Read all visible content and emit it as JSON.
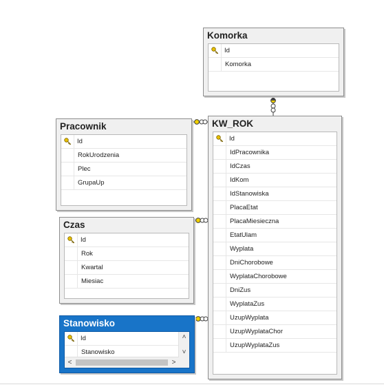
{
  "tables": {
    "komorka": {
      "title": "Komorka",
      "columns": [
        "Id",
        "Komorka"
      ]
    },
    "pracownik": {
      "title": "Pracownik",
      "columns": [
        "Id",
        "RokUrodzenia",
        "Plec",
        "GrupaUp"
      ]
    },
    "czas": {
      "title": "Czas",
      "columns": [
        "Id",
        "Rok",
        "Kwartal",
        "Miesiac"
      ]
    },
    "stanowisko": {
      "title": "Stanowisko",
      "columns": [
        "Id",
        "Stanowisko"
      ]
    },
    "kw_rok": {
      "title": "KW_ROK",
      "columns": [
        "Id",
        "IdPracownika",
        "IdCzas",
        "IdKom",
        "IdStanowiska",
        "PlacaEtat",
        "PlacaMiesieczna",
        "EtatUlam",
        "Wyplata",
        "DniChorobowe",
        "WyplataChorobowe",
        "DniZus",
        "WyplataZus",
        "UzupWyplata",
        "UzupWyplataChor",
        "UzupWyplataZus"
      ]
    }
  },
  "colors": {
    "selected_header": "#1874c8",
    "key_icon": "#e8c000",
    "link": "#606060"
  },
  "icons": {
    "primary_key": "key-icon"
  }
}
